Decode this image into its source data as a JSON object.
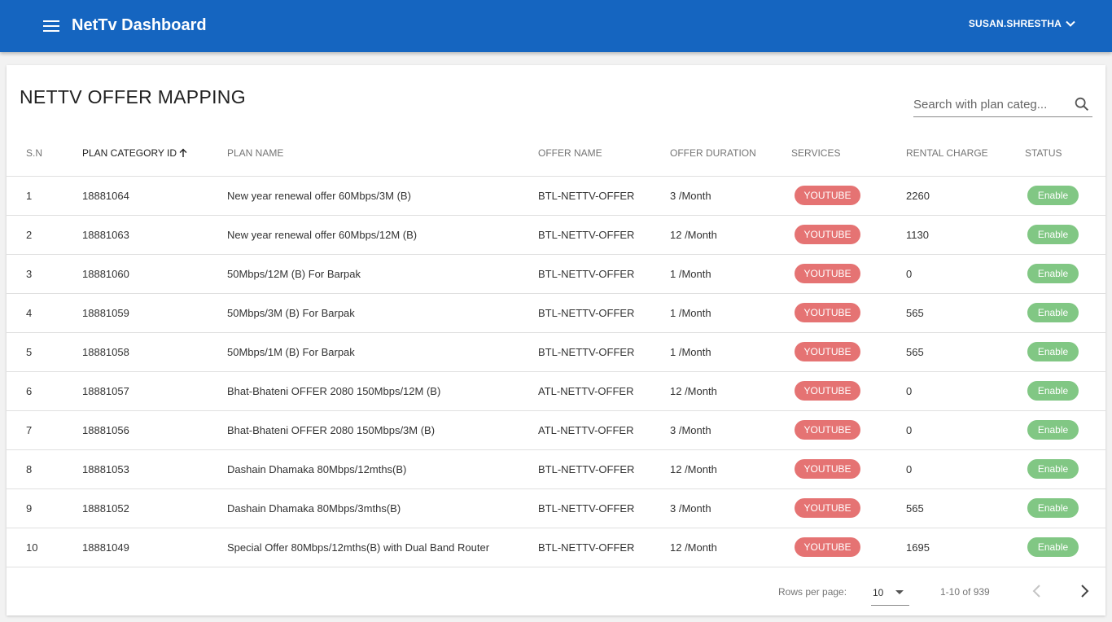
{
  "app": {
    "title": "NetTv Dashboard",
    "user": "SUSAN.SHRESTHA",
    "brand_color": "#1565c0"
  },
  "page": {
    "title": "NETTV OFFER MAPPING",
    "search_placeholder": "Search with plan categ..."
  },
  "table": {
    "headers": {
      "sn": "S.N",
      "plan_category_id": "PLAN CATEGORY ID",
      "plan_name": "PLAN NAME",
      "offer_name": "OFFER NAME",
      "offer_duration": "OFFER DURATION",
      "services": "SERVICES",
      "rental_charge": "RENTAL CHARGE",
      "status": "STATUS"
    },
    "sorted_by": "plan_category_id",
    "rows": [
      {
        "sn": "1",
        "plan_category_id": "18881064",
        "plan_name": "New year renewal offer 60Mbps/3M (B)",
        "offer_name": "BTL-NETTV-OFFER",
        "offer_duration": "3 /Month",
        "service": "YOUTUBE",
        "rental_charge": "2260",
        "status": "Enable"
      },
      {
        "sn": "2",
        "plan_category_id": "18881063",
        "plan_name": "New year renewal offer 60Mbps/12M (B)",
        "offer_name": "BTL-NETTV-OFFER",
        "offer_duration": "12 /Month",
        "service": "YOUTUBE",
        "rental_charge": "1130",
        "status": "Enable"
      },
      {
        "sn": "3",
        "plan_category_id": "18881060",
        "plan_name": "50Mbps/12M (B) For Barpak",
        "offer_name": "BTL-NETTV-OFFER",
        "offer_duration": "1 /Month",
        "service": "YOUTUBE",
        "rental_charge": "0",
        "status": "Enable"
      },
      {
        "sn": "4",
        "plan_category_id": "18881059",
        "plan_name": "50Mbps/3M (B) For Barpak",
        "offer_name": "BTL-NETTV-OFFER",
        "offer_duration": "1 /Month",
        "service": "YOUTUBE",
        "rental_charge": "565",
        "status": "Enable"
      },
      {
        "sn": "5",
        "plan_category_id": "18881058",
        "plan_name": "50Mbps/1M (B) For Barpak",
        "offer_name": "BTL-NETTV-OFFER",
        "offer_duration": "1 /Month",
        "service": "YOUTUBE",
        "rental_charge": "565",
        "status": "Enable"
      },
      {
        "sn": "6",
        "plan_category_id": "18881057",
        "plan_name": "Bhat-Bhateni OFFER 2080 150Mbps/12M (B)",
        "offer_name": "ATL-NETTV-OFFER",
        "offer_duration": "12 /Month",
        "service": "YOUTUBE",
        "rental_charge": "0",
        "status": "Enable"
      },
      {
        "sn": "7",
        "plan_category_id": "18881056",
        "plan_name": "Bhat-Bhateni OFFER 2080 150Mbps/3M (B)",
        "offer_name": "ATL-NETTV-OFFER",
        "offer_duration": "3 /Month",
        "service": "YOUTUBE",
        "rental_charge": "0",
        "status": "Enable"
      },
      {
        "sn": "8",
        "plan_category_id": "18881053",
        "plan_name": "Dashain Dhamaka 80Mbps/12mths(B)",
        "offer_name": "BTL-NETTV-OFFER",
        "offer_duration": "12 /Month",
        "service": "YOUTUBE",
        "rental_charge": "0",
        "status": "Enable"
      },
      {
        "sn": "9",
        "plan_category_id": "18881052",
        "plan_name": "Dashain Dhamaka 80Mbps/3mths(B)",
        "offer_name": "BTL-NETTV-OFFER",
        "offer_duration": "3 /Month",
        "service": "YOUTUBE",
        "rental_charge": "565",
        "status": "Enable"
      },
      {
        "sn": "10",
        "plan_category_id": "18881049",
        "plan_name": "Special Offer 80Mbps/12mths(B) with Dual Band Router",
        "offer_name": "BTL-NETTV-OFFER",
        "offer_duration": "12 /Month",
        "service": "YOUTUBE",
        "rental_charge": "1695",
        "status": "Enable"
      }
    ]
  },
  "pagination": {
    "rows_per_page_label": "Rows per page:",
    "rows_per_page": "10",
    "range": "1-10 of 939"
  },
  "colors": {
    "service_badge": "#e57373",
    "status_enable": "#81c784"
  },
  "icons": {
    "menu": "menu-icon",
    "user_dropdown": "chevron-down-icon",
    "search": "search-icon",
    "sort": "arrow-up-icon",
    "select": "caret-down-icon",
    "prev": "chevron-left-icon",
    "next": "chevron-right-icon"
  }
}
